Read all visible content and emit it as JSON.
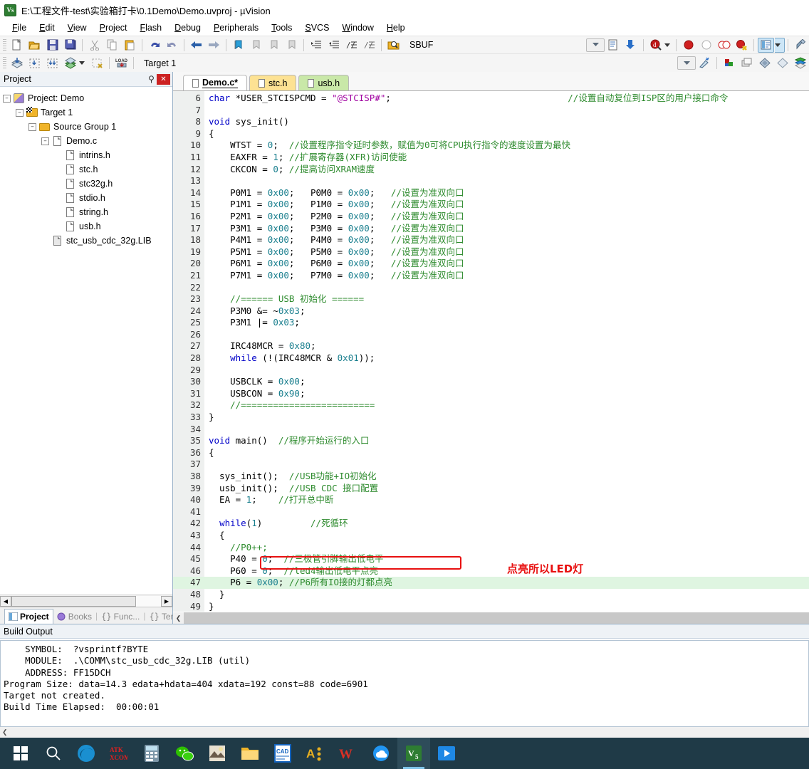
{
  "window": {
    "title": "E:\\工程文件-test\\实验箱打卡\\0.1Demo\\Demo.uvproj - µVision",
    "app_icon_text": "Vs"
  },
  "menu": [
    {
      "label": "File"
    },
    {
      "label": "Edit"
    },
    {
      "label": "View"
    },
    {
      "label": "Project"
    },
    {
      "label": "Flash"
    },
    {
      "label": "Debug"
    },
    {
      "label": "Peripherals"
    },
    {
      "label": "Tools"
    },
    {
      "label": "SVCS"
    },
    {
      "label": "Window"
    },
    {
      "label": "Help"
    }
  ],
  "toolbar1": [
    {
      "name": "new-file-icon"
    },
    {
      "name": "open-file-icon"
    },
    {
      "name": "save-icon"
    },
    {
      "name": "save-all-icon"
    },
    {
      "name": "cut-icon"
    },
    {
      "name": "copy-icon"
    },
    {
      "name": "paste-icon"
    },
    {
      "name": "undo-icon"
    },
    {
      "name": "redo-icon"
    },
    {
      "name": "navigate-back-icon"
    },
    {
      "name": "navigate-forward-icon"
    },
    {
      "name": "bookmark-toggle-icon"
    },
    {
      "name": "bookmark-prev-icon"
    },
    {
      "name": "bookmark-next-icon"
    },
    {
      "name": "bookmark-clear-icon"
    },
    {
      "name": "indent-icon"
    },
    {
      "name": "outdent-icon"
    },
    {
      "name": "comment-lines-icon"
    },
    {
      "name": "uncomment-lines-icon"
    }
  ],
  "toolbar2": {
    "target_label": "Target 1",
    "search_value": "SBUF",
    "buttons": [
      {
        "name": "build-icon"
      },
      {
        "name": "rebuild-icon"
      },
      {
        "name": "batch-build-icon"
      },
      {
        "name": "build-target-icon"
      },
      {
        "name": "stop-build-icon"
      },
      {
        "name": "download-icon"
      },
      {
        "name": "target-options-icon"
      },
      {
        "name": "manage-project-items-icon"
      },
      {
        "name": "manage-run-time-icon"
      },
      {
        "name": "multi-project-icon"
      },
      {
        "name": "books-icon"
      },
      {
        "name": "find-in-files-icon"
      },
      {
        "name": "insert-bookmark-icon"
      },
      {
        "name": "debug-search-icon"
      },
      {
        "name": "breakpoint-icon"
      },
      {
        "name": "breakpoint-disable-icon"
      },
      {
        "name": "breakpoint-disable-all-icon"
      },
      {
        "name": "breakpoint-kill-all-icon"
      },
      {
        "name": "project-window-icon"
      },
      {
        "name": "configuration-wizard-icon"
      }
    ]
  },
  "project_panel": {
    "title": "Project",
    "tree": [
      {
        "label": "Project: Demo",
        "depth": 0,
        "icon": "project-icon",
        "expander": "minus"
      },
      {
        "label": "Target 1",
        "depth": 1,
        "icon": "target-icon",
        "expander": "minus"
      },
      {
        "label": "Source Group 1",
        "depth": 2,
        "icon": "folder-icon",
        "expander": "minus"
      },
      {
        "label": "Demo.c",
        "depth": 3,
        "icon": "c-file-icon",
        "expander": "minus"
      },
      {
        "label": "intrins.h",
        "depth": 4,
        "icon": "header-file-icon",
        "expander": "none"
      },
      {
        "label": "stc.h",
        "depth": 4,
        "icon": "header-file-icon",
        "expander": "none"
      },
      {
        "label": "stc32g.h",
        "depth": 4,
        "icon": "header-file-icon",
        "expander": "none"
      },
      {
        "label": "stdio.h",
        "depth": 4,
        "icon": "header-file-icon",
        "expander": "none"
      },
      {
        "label": "string.h",
        "depth": 4,
        "icon": "header-file-icon",
        "expander": "none"
      },
      {
        "label": "usb.h",
        "depth": 4,
        "icon": "header-file-icon",
        "expander": "none"
      },
      {
        "label": "stc_usb_cdc_32g.LIB",
        "depth": 3,
        "icon": "lib-file-icon",
        "expander": "none"
      }
    ],
    "bottom_tabs": [
      {
        "label": "Project",
        "active": true
      },
      {
        "label": "Books",
        "active": false
      },
      {
        "label": "Func...",
        "active": false
      },
      {
        "label": "Temp...",
        "active": false
      }
    ]
  },
  "editor": {
    "tabs": [
      {
        "label": "Demo.c*",
        "state": "active"
      },
      {
        "label": "stc.h",
        "state": "yellow"
      },
      {
        "label": "usb.h",
        "state": "green"
      }
    ],
    "first_line": 6,
    "highlight_line": 47,
    "annotation": {
      "text": "点亮所以LED灯",
      "color": "#e81010"
    },
    "lines": [
      {
        "n": 6,
        "segs": [
          {
            "t": "char ",
            "c": "kw"
          },
          {
            "t": "*USER_STCISPCMD = ",
            "c": "pln"
          },
          {
            "t": "\"@STCISP#\"",
            "c": "str"
          },
          {
            "t": ";",
            "c": "pln"
          },
          {
            "t": "                                 ",
            "c": "pln"
          },
          {
            "t": "//设置自动复位到ISP区的用户接口命令",
            "c": "cmt"
          }
        ]
      },
      {
        "n": 7,
        "segs": []
      },
      {
        "n": 8,
        "segs": [
          {
            "t": "void ",
            "c": "kw"
          },
          {
            "t": "sys_init()",
            "c": "pln"
          }
        ]
      },
      {
        "n": 9,
        "segs": [
          {
            "t": "{",
            "c": "pln"
          }
        ]
      },
      {
        "n": 10,
        "segs": [
          {
            "t": "    WTST = ",
            "c": "pln"
          },
          {
            "t": "0",
            "c": "num"
          },
          {
            "t": ";  ",
            "c": "pln"
          },
          {
            "t": "//设置程序指令延时参数，赋值为0可将CPU执行指令的速度设置为最快",
            "c": "cmt"
          }
        ]
      },
      {
        "n": 11,
        "segs": [
          {
            "t": "    EAXFR = ",
            "c": "pln"
          },
          {
            "t": "1",
            "c": "num"
          },
          {
            "t": "; ",
            "c": "pln"
          },
          {
            "t": "//扩展寄存器(XFR)访问使能",
            "c": "cmt"
          }
        ]
      },
      {
        "n": 12,
        "segs": [
          {
            "t": "    CKCON = ",
            "c": "pln"
          },
          {
            "t": "0",
            "c": "num"
          },
          {
            "t": "; ",
            "c": "pln"
          },
          {
            "t": "//提高访问XRAM速度",
            "c": "cmt"
          }
        ]
      },
      {
        "n": 13,
        "segs": []
      },
      {
        "n": 14,
        "segs": [
          {
            "t": "    P0M1 = ",
            "c": "pln"
          },
          {
            "t": "0x00",
            "c": "num"
          },
          {
            "t": ";   P0M0 = ",
            "c": "pln"
          },
          {
            "t": "0x00",
            "c": "num"
          },
          {
            "t": ";   ",
            "c": "pln"
          },
          {
            "t": "//设置为准双向口",
            "c": "cmt"
          }
        ]
      },
      {
        "n": 15,
        "segs": [
          {
            "t": "    P1M1 = ",
            "c": "pln"
          },
          {
            "t": "0x00",
            "c": "num"
          },
          {
            "t": ";   P1M0 = ",
            "c": "pln"
          },
          {
            "t": "0x00",
            "c": "num"
          },
          {
            "t": ";   ",
            "c": "pln"
          },
          {
            "t": "//设置为准双向口",
            "c": "cmt"
          }
        ]
      },
      {
        "n": 16,
        "segs": [
          {
            "t": "    P2M1 = ",
            "c": "pln"
          },
          {
            "t": "0x00",
            "c": "num"
          },
          {
            "t": ";   P2M0 = ",
            "c": "pln"
          },
          {
            "t": "0x00",
            "c": "num"
          },
          {
            "t": ";   ",
            "c": "pln"
          },
          {
            "t": "//设置为准双向口",
            "c": "cmt"
          }
        ]
      },
      {
        "n": 17,
        "segs": [
          {
            "t": "    P3M1 = ",
            "c": "pln"
          },
          {
            "t": "0x00",
            "c": "num"
          },
          {
            "t": ";   P3M0 = ",
            "c": "pln"
          },
          {
            "t": "0x00",
            "c": "num"
          },
          {
            "t": ";   ",
            "c": "pln"
          },
          {
            "t": "//设置为准双向口",
            "c": "cmt"
          }
        ]
      },
      {
        "n": 18,
        "segs": [
          {
            "t": "    P4M1 = ",
            "c": "pln"
          },
          {
            "t": "0x00",
            "c": "num"
          },
          {
            "t": ";   P4M0 = ",
            "c": "pln"
          },
          {
            "t": "0x00",
            "c": "num"
          },
          {
            "t": ";   ",
            "c": "pln"
          },
          {
            "t": "//设置为准双向口",
            "c": "cmt"
          }
        ]
      },
      {
        "n": 19,
        "segs": [
          {
            "t": "    P5M1 = ",
            "c": "pln"
          },
          {
            "t": "0x00",
            "c": "num"
          },
          {
            "t": ";   P5M0 = ",
            "c": "pln"
          },
          {
            "t": "0x00",
            "c": "num"
          },
          {
            "t": ";   ",
            "c": "pln"
          },
          {
            "t": "//设置为准双向口",
            "c": "cmt"
          }
        ]
      },
      {
        "n": 20,
        "segs": [
          {
            "t": "    P6M1 = ",
            "c": "pln"
          },
          {
            "t": "0x00",
            "c": "num"
          },
          {
            "t": ";   P6M0 = ",
            "c": "pln"
          },
          {
            "t": "0x00",
            "c": "num"
          },
          {
            "t": ";   ",
            "c": "pln"
          },
          {
            "t": "//设置为准双向口",
            "c": "cmt"
          }
        ]
      },
      {
        "n": 21,
        "segs": [
          {
            "t": "    P7M1 = ",
            "c": "pln"
          },
          {
            "t": "0x00",
            "c": "num"
          },
          {
            "t": ";   P7M0 = ",
            "c": "pln"
          },
          {
            "t": "0x00",
            "c": "num"
          },
          {
            "t": ";   ",
            "c": "pln"
          },
          {
            "t": "//设置为准双向口",
            "c": "cmt"
          }
        ]
      },
      {
        "n": 22,
        "segs": []
      },
      {
        "n": 23,
        "segs": [
          {
            "t": "    ",
            "c": "pln"
          },
          {
            "t": "//====== USB 初始化 ======",
            "c": "cmt"
          }
        ]
      },
      {
        "n": 24,
        "segs": [
          {
            "t": "    P3M0 &= ~",
            "c": "pln"
          },
          {
            "t": "0x03",
            "c": "num"
          },
          {
            "t": ";",
            "c": "pln"
          }
        ]
      },
      {
        "n": 25,
        "segs": [
          {
            "t": "    P3M1 |= ",
            "c": "pln"
          },
          {
            "t": "0x03",
            "c": "num"
          },
          {
            "t": ";",
            "c": "pln"
          }
        ]
      },
      {
        "n": 26,
        "segs": []
      },
      {
        "n": 27,
        "segs": [
          {
            "t": "    IRC48MCR = ",
            "c": "pln"
          },
          {
            "t": "0x80",
            "c": "num"
          },
          {
            "t": ";",
            "c": "pln"
          }
        ]
      },
      {
        "n": 28,
        "segs": [
          {
            "t": "    ",
            "c": "pln"
          },
          {
            "t": "while",
            "c": "kw"
          },
          {
            "t": " (!(IRC48MCR & ",
            "c": "pln"
          },
          {
            "t": "0x01",
            "c": "num"
          },
          {
            "t": "));",
            "c": "pln"
          }
        ]
      },
      {
        "n": 29,
        "segs": []
      },
      {
        "n": 30,
        "segs": [
          {
            "t": "    USBCLK = ",
            "c": "pln"
          },
          {
            "t": "0x00",
            "c": "num"
          },
          {
            "t": ";",
            "c": "pln"
          }
        ]
      },
      {
        "n": 31,
        "segs": [
          {
            "t": "    USBCON = ",
            "c": "pln"
          },
          {
            "t": "0x90",
            "c": "num"
          },
          {
            "t": ";",
            "c": "pln"
          }
        ]
      },
      {
        "n": 32,
        "segs": [
          {
            "t": "    ",
            "c": "pln"
          },
          {
            "t": "//=========================",
            "c": "cmt"
          }
        ]
      },
      {
        "n": 33,
        "segs": [
          {
            "t": "}",
            "c": "pln"
          }
        ]
      },
      {
        "n": 34,
        "segs": []
      },
      {
        "n": 35,
        "segs": [
          {
            "t": "void ",
            "c": "kw"
          },
          {
            "t": "main()  ",
            "c": "pln"
          },
          {
            "t": "//程序开始运行的入口",
            "c": "cmt"
          }
        ]
      },
      {
        "n": 36,
        "segs": [
          {
            "t": "{",
            "c": "pln"
          }
        ]
      },
      {
        "n": 37,
        "segs": []
      },
      {
        "n": 38,
        "segs": [
          {
            "t": "  sys_init();  ",
            "c": "pln"
          },
          {
            "t": "//USB功能+IO初始化",
            "c": "cmt"
          }
        ]
      },
      {
        "n": 39,
        "segs": [
          {
            "t": "  usb_init();  ",
            "c": "pln"
          },
          {
            "t": "//USB CDC 接口配置",
            "c": "cmt"
          }
        ]
      },
      {
        "n": 40,
        "segs": [
          {
            "t": "  EA = ",
            "c": "pln"
          },
          {
            "t": "1",
            "c": "num"
          },
          {
            "t": ";    ",
            "c": "pln"
          },
          {
            "t": "//打开总中断",
            "c": "cmt"
          }
        ]
      },
      {
        "n": 41,
        "segs": []
      },
      {
        "n": 42,
        "segs": [
          {
            "t": "  ",
            "c": "pln"
          },
          {
            "t": "while",
            "c": "kw"
          },
          {
            "t": "(",
            "c": "pln"
          },
          {
            "t": "1",
            "c": "num"
          },
          {
            "t": ")         ",
            "c": "pln"
          },
          {
            "t": "//死循环",
            "c": "cmt"
          }
        ]
      },
      {
        "n": 43,
        "segs": [
          {
            "t": "  {",
            "c": "pln"
          }
        ]
      },
      {
        "n": 44,
        "segs": [
          {
            "t": "    ",
            "c": "pln"
          },
          {
            "t": "//P0++;",
            "c": "cmt"
          }
        ]
      },
      {
        "n": 45,
        "segs": [
          {
            "t": "    P40 = ",
            "c": "pln"
          },
          {
            "t": "0",
            "c": "num"
          },
          {
            "t": ";  ",
            "c": "pln"
          },
          {
            "t": "//三极管引脚输出低电平",
            "c": "cmt"
          }
        ]
      },
      {
        "n": 46,
        "segs": [
          {
            "t": "    P60 = ",
            "c": "pln"
          },
          {
            "t": "0",
            "c": "num"
          },
          {
            "t": ";  ",
            "c": "pln"
          },
          {
            "t": "//led4输出低电平点亮",
            "c": "cmt"
          }
        ]
      },
      {
        "n": 47,
        "segs": [
          {
            "t": "    P6 = ",
            "c": "pln"
          },
          {
            "t": "0x00",
            "c": "num"
          },
          {
            "t": "; ",
            "c": "pln"
          },
          {
            "t": "//P6所有IO接的灯都点亮",
            "c": "cmt"
          }
        ]
      },
      {
        "n": 48,
        "segs": [
          {
            "t": "  }",
            "c": "pln"
          }
        ]
      },
      {
        "n": 49,
        "segs": [
          {
            "t": "}",
            "c": "pln"
          }
        ]
      },
      {
        "n": 50,
        "segs": []
      }
    ]
  },
  "build_output": {
    "title": "Build Output",
    "lines": [
      "    SYMBOL:  ?vsprintf?BYTE",
      "    MODULE:  .\\COMM\\stc_usb_cdc_32g.LIB (util)",
      "    ADDRESS: FF15DCH",
      "Program Size: data=14.3 edata+hdata=404 xdata=192 const=88 code=6901",
      "Target not created.",
      "Build Time Elapsed:  00:00:01"
    ]
  },
  "taskbar": {
    "items": [
      {
        "name": "start-button",
        "glyph": "⊞",
        "color": "#1f3a47",
        "text": ""
      },
      {
        "name": "search-icon",
        "glyph": "○",
        "color": "#1f3a47",
        "text": ""
      },
      {
        "name": "edge-icon",
        "glyph": "",
        "color": "#1a6fb5",
        "text": ""
      },
      {
        "name": "atk-xcom-icon",
        "glyph": "",
        "color": "#1f3a47",
        "text": "ATK"
      },
      {
        "name": "calculator-icon",
        "glyph": "",
        "color": "#5a7a8c",
        "text": ""
      },
      {
        "name": "wechat-icon",
        "glyph": "",
        "color": "#2dc100",
        "text": ""
      },
      {
        "name": "photo-app-icon",
        "glyph": "",
        "color": "#8a6a4a",
        "text": ""
      },
      {
        "name": "file-explorer-icon",
        "glyph": "",
        "color": "#f0b429",
        "text": ""
      },
      {
        "name": "cad-icon",
        "glyph": "",
        "color": "#1565c0",
        "text": "CAD"
      },
      {
        "name": "altium-icon",
        "glyph": "",
        "color": "#1c1c1c",
        "text": "A"
      },
      {
        "name": "wps-icon",
        "glyph": "",
        "color": "#d93025",
        "text": "W"
      },
      {
        "name": "cloud-drive-icon",
        "glyph": "",
        "color": "#2196f3",
        "text": ""
      },
      {
        "name": "uvision-icon",
        "glyph": "",
        "color": "#2e7d32",
        "text": "Vs"
      },
      {
        "name": "media-player-icon",
        "glyph": "",
        "color": "#1e88e5",
        "text": ""
      }
    ],
    "active_index": 12
  }
}
